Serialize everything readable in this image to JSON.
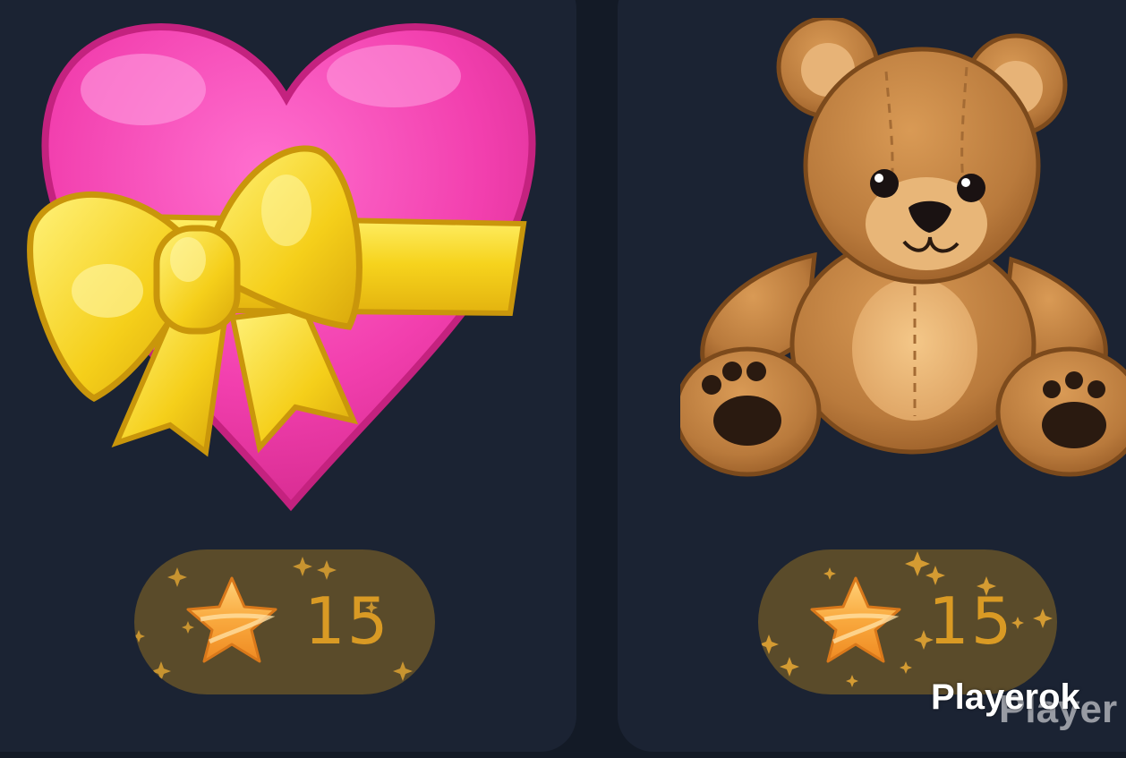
{
  "gifts": [
    {
      "name": "heart-with-ribbon",
      "icon": "heart-with-ribbon-icon",
      "price": "15",
      "price_icon": "star-icon"
    },
    {
      "name": "teddy-bear",
      "icon": "teddy-bear-icon",
      "price": "15",
      "price_icon": "star-icon"
    }
  ],
  "watermark": {
    "text": "Playerok",
    "shadow_text": "Player"
  },
  "colors": {
    "background": "#131a26",
    "card": "#1b2333",
    "pill": "#5a4b2a",
    "price_text": "#d99a24",
    "star": "#f7a93a",
    "heart": "#ee3fa6",
    "ribbon": "#f2d21c",
    "bear": "#b0733a"
  }
}
